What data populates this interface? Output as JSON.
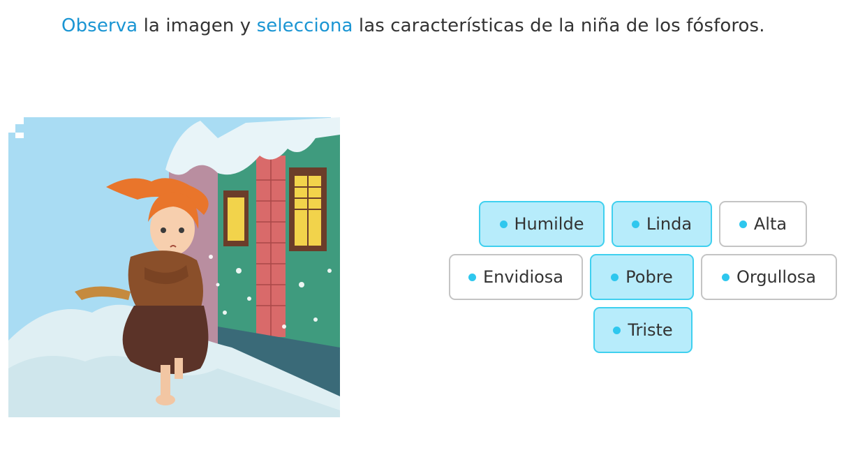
{
  "instruction": {
    "part1": "Observa",
    "part2": " la imagen y ",
    "part3": "selecciona",
    "part4": " las características de la niña de los fósforos."
  },
  "options": [
    {
      "label": "Humilde",
      "selected": true
    },
    {
      "label": "Linda",
      "selected": true
    },
    {
      "label": "Alta",
      "selected": false
    },
    {
      "label": "Envidiosa",
      "selected": false
    },
    {
      "label": "Pobre",
      "selected": true
    },
    {
      "label": "Orgullosa",
      "selected": false
    },
    {
      "label": "Triste",
      "selected": true
    }
  ],
  "colors": {
    "highlight_text": "#1a95d3",
    "selected_border": "#3fd0ef",
    "selected_fill": "#b7ecfb",
    "dot": "#2ec7ee",
    "unselected_border": "#c4c4c4"
  }
}
